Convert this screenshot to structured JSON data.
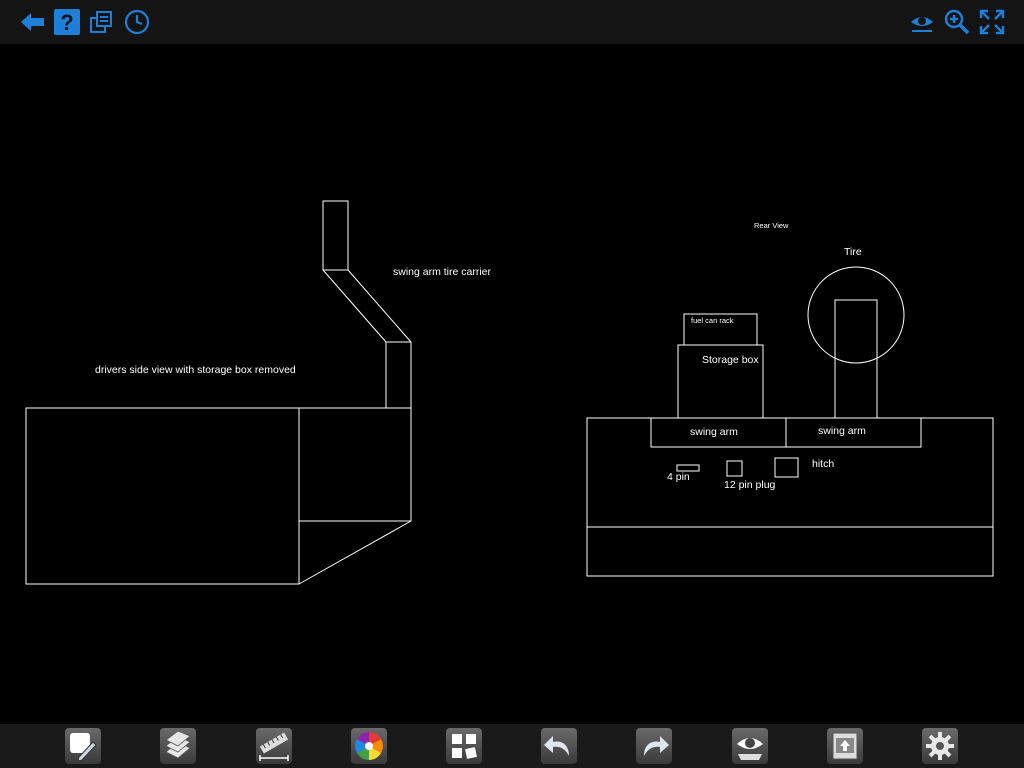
{
  "toolbar_top": {
    "left_icons": [
      "back-arrow-icon",
      "help-icon",
      "layers-stack-icon",
      "history-clock-icon"
    ],
    "right_icons": [
      "view-eye-icon",
      "zoom-icon",
      "fullscreen-icon"
    ],
    "accent_color": "#1e7fd8"
  },
  "drawing": {
    "side_view_caption": "drivers side view with storage box removed",
    "carrier_label": "swing arm tire carrier",
    "rear_view_title": "Rear View",
    "tire_label": "Tire",
    "fuel_can_label": "fuel can rack",
    "storage_box_label": "Storage box",
    "swing_arm_left_label": "swing arm",
    "swing_arm_right_label": "swing arm",
    "four_pin_label": "4 pin",
    "twelve_pin_label": "12 pin plug",
    "hitch_label": "hitch",
    "stroke_color": "#ffffff",
    "background_color": "#000000"
  },
  "toolbar_bottom": {
    "icons": [
      "draw-tool-icon",
      "layers-icon",
      "measure-ruler-icon",
      "color-wheel-icon",
      "shapes-grid-icon",
      "undo-icon",
      "redo-icon",
      "view-mode-icon",
      "export-icon",
      "settings-gear-icon"
    ]
  }
}
